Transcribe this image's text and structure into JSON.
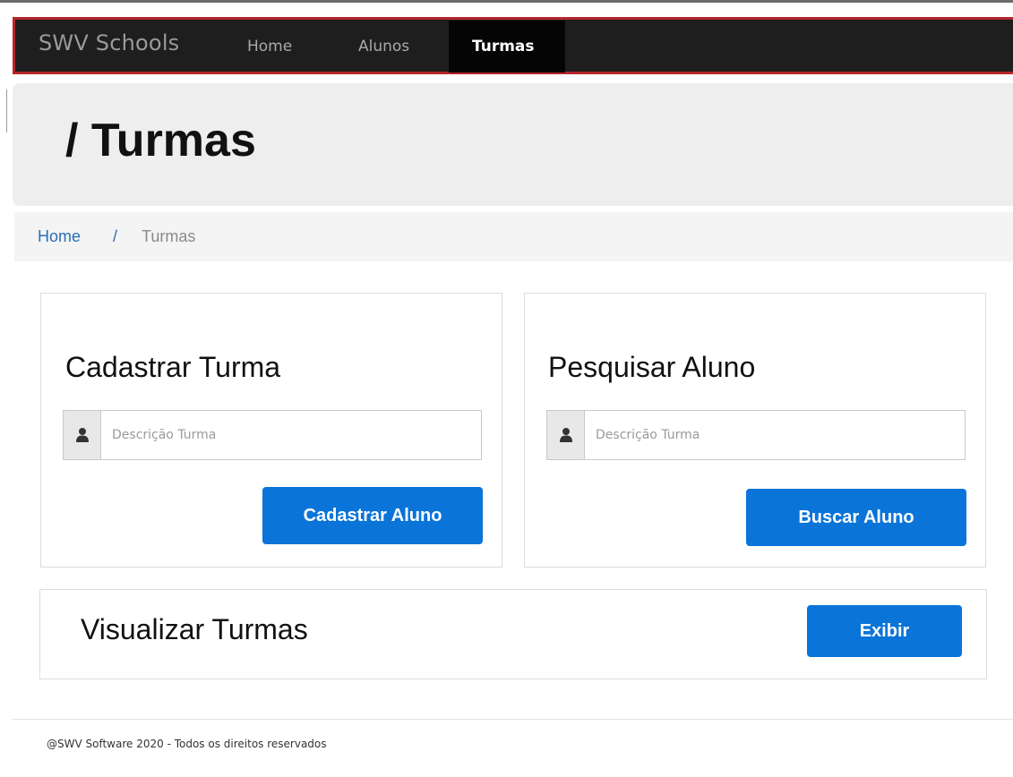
{
  "navbar": {
    "brand": "SWV Schools",
    "items": [
      {
        "label": "Home"
      },
      {
        "label": "Alunos"
      },
      {
        "label": "Turmas"
      }
    ]
  },
  "jumbotron": {
    "title": "/ Turmas"
  },
  "breadcrumb": {
    "home": "Home",
    "separator": "/",
    "current": "Turmas"
  },
  "cadastrar": {
    "title": "Cadastrar Turma",
    "input_placeholder": "Descrição Turma",
    "input_value": "",
    "button_label": "Cadastrar Aluno",
    "icon": "user-icon"
  },
  "pesquisar": {
    "title": "Pesquisar Aluno",
    "input_placeholder": "Descrição Turma",
    "input_value": "",
    "button_label": "Buscar Aluno",
    "icon": "user-icon"
  },
  "visualizar": {
    "title": "Visualizar Turmas",
    "button_label": "Exibir"
  },
  "footer": {
    "text": "@SWV Software 2020 - Todos os direitos reservados"
  },
  "colors": {
    "navbar_bg": "#1e1e1e",
    "navbar_border": "#b7262c",
    "active_nav_bg": "#050505",
    "primary_button": "#0a74d8",
    "breadcrumb_link": "#2a6fb5",
    "jumbotron_bg": "#eeeeee"
  }
}
